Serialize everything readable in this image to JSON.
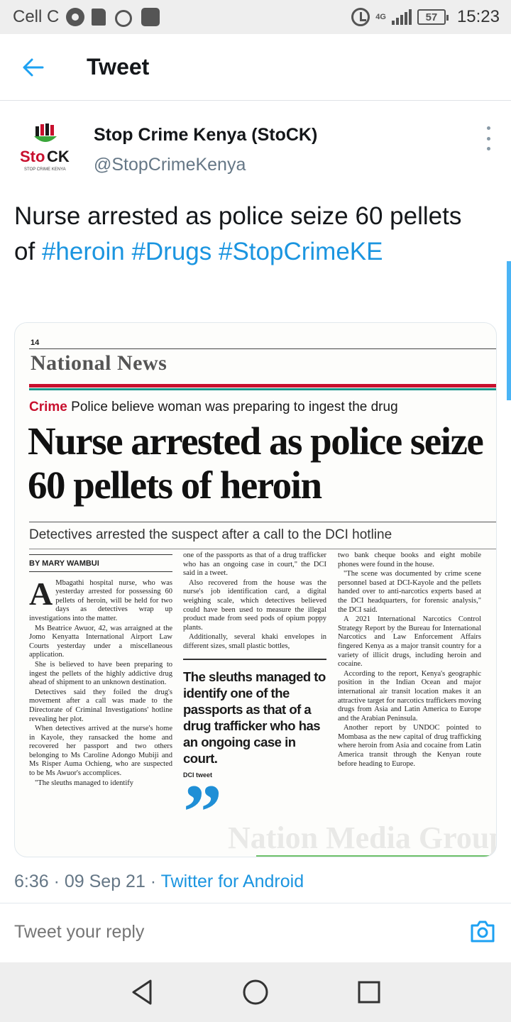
{
  "status_bar": {
    "carrier": "Cell C",
    "network": "4G",
    "battery": "57",
    "time": "15:23"
  },
  "header": {
    "title": "Tweet",
    "back_icon": "arrow-left-icon"
  },
  "tweet": {
    "author_name": "Stop Crime Kenya (StoCK)",
    "author_handle": "@StopCrimeKenya",
    "avatar_logo_text": "StoCK",
    "avatar_tagline": "STOP CRIME KENYA",
    "text_plain": "Nurse arrested as police seize 60 pellets of",
    "hashtags": [
      "#heroin",
      "#Drugs",
      "#StopCrimeKE"
    ],
    "timestamp": "6:36 · 09 Sep 21 · ",
    "source": "Twitter for Android"
  },
  "newspaper": {
    "page_number": "14",
    "section": "National News",
    "kicker_label": "Crime",
    "kicker_text": "Police believe woman was preparing to ingest the drug",
    "headline": "Nurse arrested as police seize 60 pellets of heroin",
    "standfirst": "Detectives arrested the suspect after a call to the DCI hotline",
    "byline": "BY MARY WAMBUI",
    "dropcap": "A",
    "col1": [
      "Mbagathi hospital nurse, who was yesterday arrested for possessing 60 pellets of heroin, will be held for two days as detectives wrap up investigations into the matter.",
      "Ms Beatrice Awuor, 42, was arraigned at the Jomo Kenyatta International Airport Law Courts yesterday under a miscellaneous application.",
      "She is believed to have been preparing to ingest the pellets of the highly addictive drug ahead of shipment to an unknown destination.",
      "Detectives said they foiled the drug's movement after a call was made to the Directorate of Criminal Investigations' hotline revealing her plot.",
      "When detectives arrived at the nurse's home in Kayole, they ransacked the home and recovered her passport and two others belonging to Ms Caroline Adongo Mubiji and Ms Risper Auma Ochieng, who are suspected to be Ms Awuor's accomplices.",
      "\"The sleuths managed to identify"
    ],
    "col2": [
      "one of the passports as that of a drug trafficker who has an ongoing case in court,\" the DCI said in a tweet.",
      "Also recovered from the house was the nurse's job identification card, a digital weighing scale, which detectives believed could have been used to measure the illegal product made from seed pods of opium poppy plants.",
      "Additionally, several khaki envelopes in different sizes, small plastic bottles,"
    ],
    "pull_quote": "The sleuths managed to identify one of the passports as that of a drug trafficker who has an ongoing case in court.",
    "pull_source": "DCI tweet",
    "col3": [
      "two bank cheque books and eight mobile phones were found in the house.",
      "\"The scene was documented by crime scene personnel based at DCI-Kayole and the pellets handed over to anti-narcotics experts based at the DCI headquarters, for forensic analysis,\" the DCI said.",
      "A 2021 International Narcotics Control Strategy Report by the Bureau for International Narcotics and Law Enforcement Affairs fingered Kenya as a major transit country for a variety of illicit drugs, including heroin and cocaine.",
      "According to the report, Kenya's geographic position in the Indian Ocean and major international air transit location makes it an attractive target for narcotics traffickers moving drugs from Asia and Latin America to Europe and the Arabian Peninsula.",
      "Another report by UNDOC pointed to Mombasa as the new capital of drug trafficking where heroin from Asia and cocaine from Latin America transit through the Kenyan route before heading to Europe."
    ],
    "watermark": "Nation Media Group"
  },
  "reply": {
    "placeholder": "Tweet your reply",
    "camera_icon": "camera-icon"
  },
  "nav": {
    "back_icon": "triangle-back-icon",
    "home_icon": "circle-home-icon",
    "recents_icon": "square-recents-icon"
  },
  "colors": {
    "accent": "#1da1f2",
    "link": "#1b95e0",
    "muted": "#657786"
  }
}
